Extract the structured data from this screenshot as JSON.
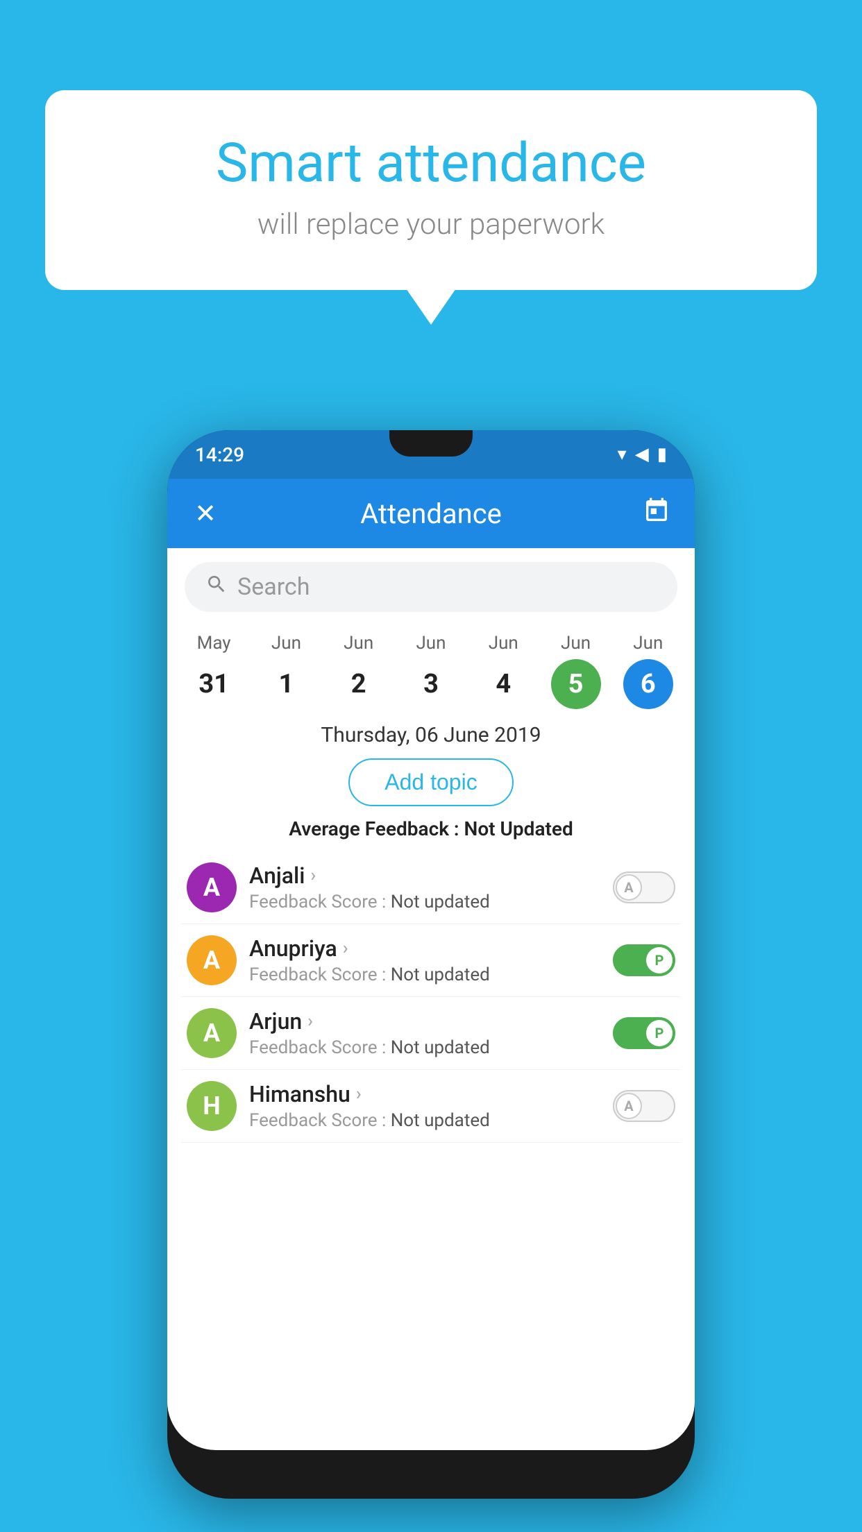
{
  "background_color": "#29b6e8",
  "speech_bubble": {
    "title": "Smart attendance",
    "subtitle": "will replace your paperwork"
  },
  "status_bar": {
    "time": "14:29",
    "wifi": "▲",
    "signal": "◀",
    "battery": "▮"
  },
  "app_bar": {
    "title": "Attendance",
    "close_label": "✕",
    "calendar_icon": "📅"
  },
  "search": {
    "placeholder": "Search"
  },
  "calendar": {
    "days": [
      {
        "month": "May",
        "date": "31",
        "selected": ""
      },
      {
        "month": "Jun",
        "date": "1",
        "selected": ""
      },
      {
        "month": "Jun",
        "date": "2",
        "selected": ""
      },
      {
        "month": "Jun",
        "date": "3",
        "selected": ""
      },
      {
        "month": "Jun",
        "date": "4",
        "selected": ""
      },
      {
        "month": "Jun",
        "date": "5",
        "selected": "green"
      },
      {
        "month": "Jun",
        "date": "6",
        "selected": "blue"
      }
    ]
  },
  "selected_date": "Thursday, 06 June 2019",
  "add_topic_label": "Add topic",
  "feedback_avg_label": "Average Feedback :",
  "feedback_avg_value": "Not Updated",
  "students": [
    {
      "name": "Anjali",
      "avatar_letter": "A",
      "avatar_color": "#9c27b0",
      "feedback_label": "Feedback Score :",
      "feedback_value": "Not updated",
      "attendance": "off",
      "toggle_letter": "A"
    },
    {
      "name": "Anupriya",
      "avatar_letter": "A",
      "avatar_color": "#f5a623",
      "feedback_label": "Feedback Score :",
      "feedback_value": "Not updated",
      "attendance": "present",
      "toggle_letter": "P"
    },
    {
      "name": "Arjun",
      "avatar_letter": "A",
      "avatar_color": "#8bc34a",
      "feedback_label": "Feedback Score :",
      "feedback_value": "Not updated",
      "attendance": "present",
      "toggle_letter": "P"
    },
    {
      "name": "Himanshu",
      "avatar_letter": "H",
      "avatar_color": "#8bc34a",
      "feedback_label": "Feedback Score :",
      "feedback_value": "Not updated",
      "attendance": "off",
      "toggle_letter": "A"
    }
  ]
}
